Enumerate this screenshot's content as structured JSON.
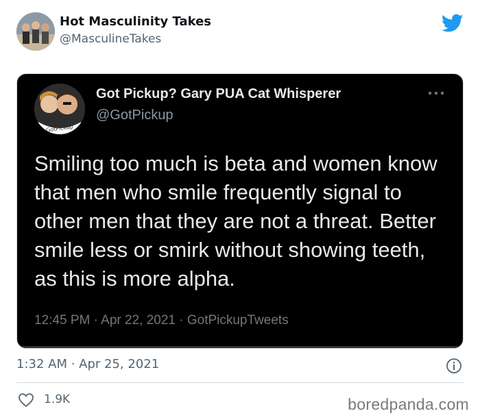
{
  "outer_tweet": {
    "display_name": "Hot Masculinity Takes",
    "handle": "@MasculineTakes",
    "timestamp": "1:32 AM · Apr 25, 2021",
    "like_count": "1.9K"
  },
  "embedded_tweet": {
    "display_name": "Got Pickup? Gary PUA Cat Whisperer",
    "handle": "@GotPickup",
    "avatar_badge": "GotPickup",
    "text": "Smiling too much is beta and women know that men who smile frequently signal to other men that they are not a threat. Better smile less or smirk without showing teeth, as this is more alpha.",
    "meta": "12:45 PM · Apr 22, 2021 · GotPickupTweets"
  },
  "watermark": "boredpanda.com",
  "icons": {
    "brand": "twitter-bird-icon",
    "more": "more-options-icon",
    "info": "info-icon",
    "like": "heart-icon"
  },
  "colors": {
    "twitter_blue": "#1d9bf0",
    "text_primary": "#0f1419",
    "text_secondary": "#536471",
    "card_background": "#000000"
  }
}
